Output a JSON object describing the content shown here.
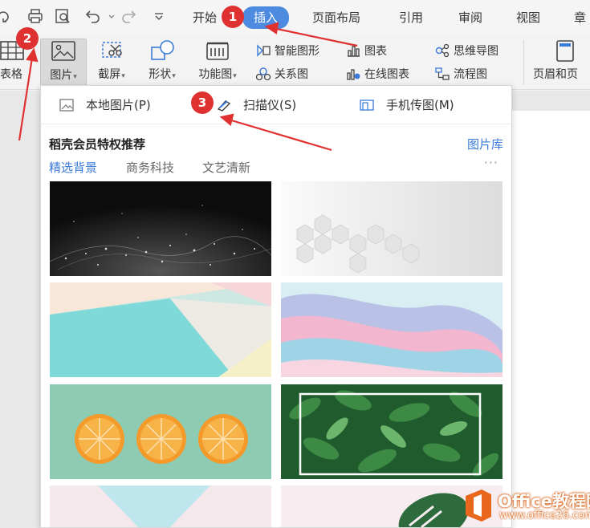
{
  "tabs": [
    "开始",
    "插入",
    "页面布局",
    "引用",
    "审阅",
    "视图",
    "章"
  ],
  "active_tab": "插入",
  "ribbon": {
    "table_label": "表格",
    "picture_label": "图片",
    "screenshot_label": "截屏",
    "shape_label": "形状",
    "function_label": "功能图",
    "smartart_label": "智能图形",
    "chart_label": "图表",
    "mindmap_label": "思维导图",
    "relation_label": "关系图",
    "online_chart_label": "在线图表",
    "flowchart_label": "流程图",
    "header_label": "页眉和页"
  },
  "panel": {
    "menu": {
      "local": "本地图片(P)",
      "scanner": "扫描仪(S)",
      "phone": "手机传图(M)"
    },
    "section_title": "稻壳会员特权推荐",
    "library_link": "图片库",
    "categories": [
      "精选背景",
      "商务科技",
      "文艺清新"
    ],
    "more": "···"
  },
  "badges": [
    "1",
    "2",
    "3"
  ],
  "watermark": {
    "title": "Office教程网",
    "url": "www.office26.com"
  },
  "colors": {
    "accent": "#4d8be0",
    "link": "#3a7ad8",
    "annotation": "#e03131"
  }
}
